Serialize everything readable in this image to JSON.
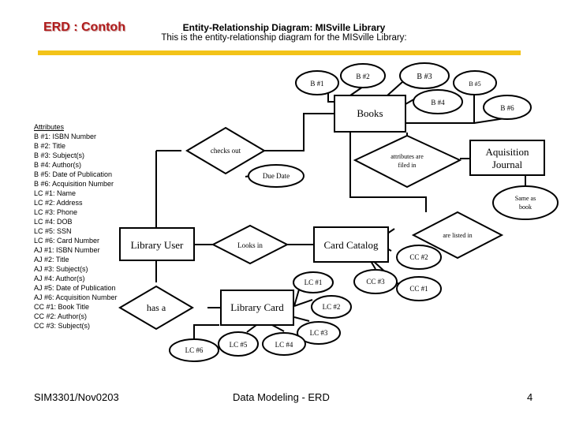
{
  "header": {
    "slide_title": "ERD : Contoh",
    "diagram_heading": "Entity-Relationship Diagram: MISville Library",
    "diagram_subheading": "This is the entity-relationship diagram for the MISville Library:",
    "accent_color": "#f3c319",
    "title_color": "#b01c1c"
  },
  "attributes": {
    "heading": "Attributes",
    "items": [
      "B #1:  ISBN Number",
      "B #2:  Title",
      "B #3:  Subject(s)",
      "B #4:  Author(s)",
      "B #5:  Date of Publication",
      "B #6:  Acquisition Number",
      "LC #1:  Name",
      "LC #2:  Address",
      "LC #3:  Phone",
      "LC #4:  DOB",
      "LC #5:  SSN",
      "LC #6:  Card Number",
      "AJ #1:  ISBN Number",
      "AJ #2:  Title",
      "AJ #3:  Subject(s)",
      "AJ #4:  Author(s)",
      "AJ #5:  Date of Publication",
      "AJ #6:  Acquisition Number",
      "CC #1:  Book Title",
      "CC #2:  Author(s)",
      "CC #3:  Subject(s)"
    ]
  },
  "diagram": {
    "entities": {
      "books": "Books",
      "library_user": "Library User",
      "card_catalog": "Card Catalog",
      "library_card": "Library Card",
      "acquisition_journal_1": "Aquisition",
      "acquisition_journal_2": "Journal"
    },
    "relationships": {
      "checks_out": "checks out",
      "attributes_filed_1": "attributes are",
      "attributes_filed_2": "filed in",
      "looks_in": "Looks in",
      "are_listed_in": "are listed in",
      "has_a": "has a"
    },
    "attribute_ovals": {
      "b1": "B #1",
      "b2": "B #2",
      "b3": "B #3",
      "b4": "B #4",
      "b5": "B #5",
      "b6": "B #6",
      "due_date": "Due Date",
      "same_as_book_1": "Same as",
      "same_as_book_2": "book",
      "cc1": "CC #1",
      "cc2": "CC #2",
      "cc3": "CC #3",
      "lc1": "LC #1",
      "lc2": "LC #2",
      "lc3": "LC #3",
      "lc4": "LC #4",
      "lc5": "LC #5",
      "lc6": "LC #6"
    }
  },
  "footer": {
    "left": "SIM3301/Nov0203",
    "center": "Data Modeling - ERD",
    "page_number": "4"
  }
}
